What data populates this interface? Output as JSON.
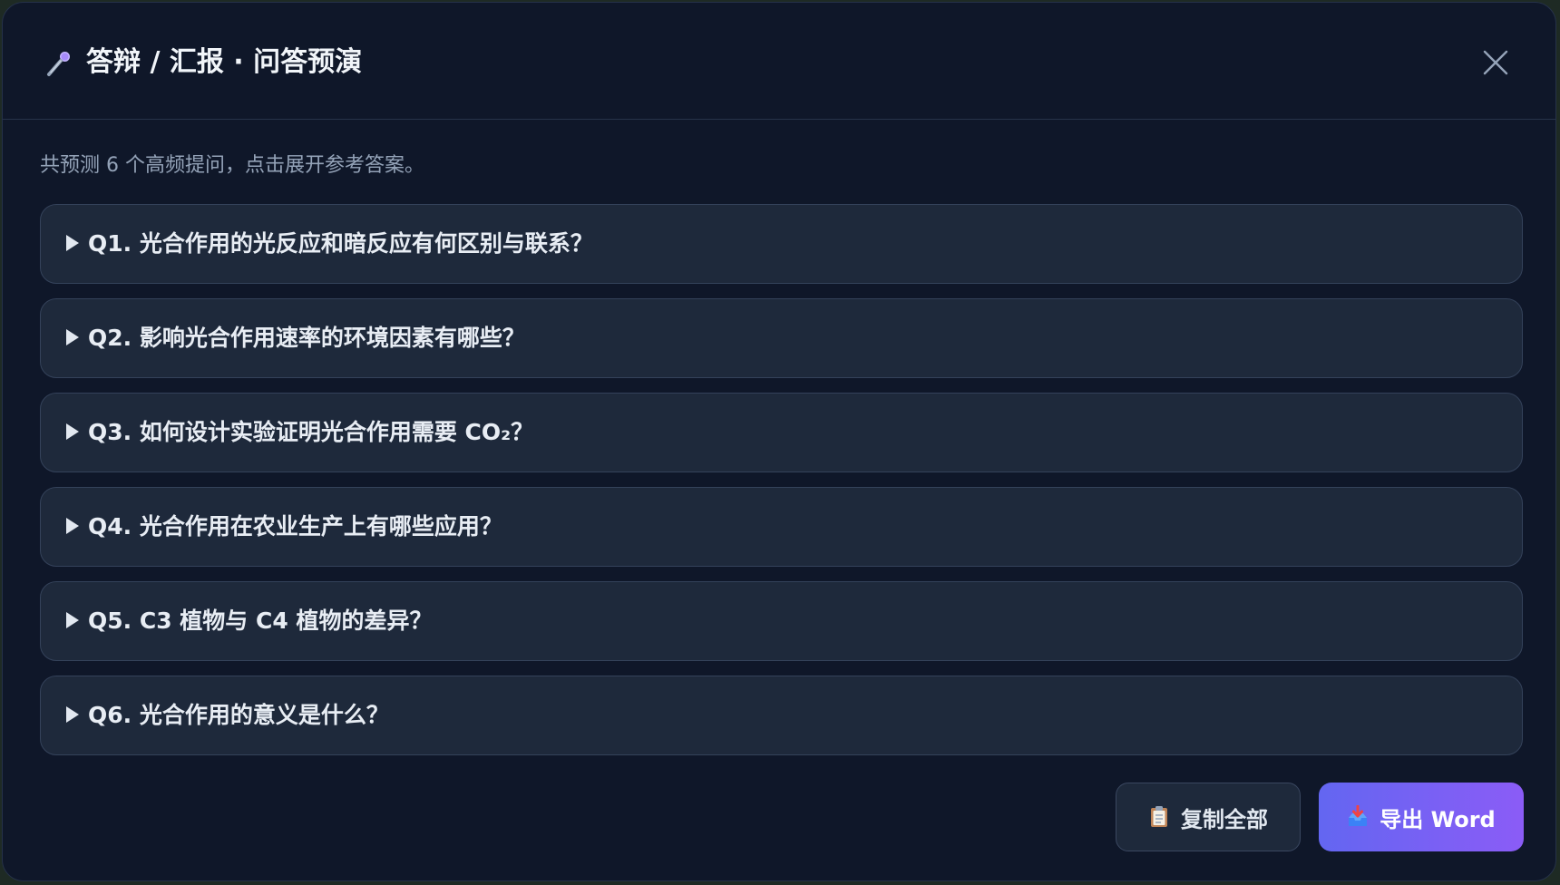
{
  "dialog": {
    "title_icon": "microphone-icon",
    "title": "答辩 / 汇报 · 问答预演",
    "close_icon": "close-icon"
  },
  "summary": "共预测 6 个高频提问，点击展开参考答案。",
  "questions": [
    {
      "label": "Q1. 光合作用的光反应和暗反应有何区别与联系？"
    },
    {
      "label": "Q2. 影响光合作用速率的环境因素有哪些？"
    },
    {
      "label": "Q3. 如何设计实验证明光合作用需要 CO₂？"
    },
    {
      "label": "Q4. 光合作用在农业生产上有哪些应用？"
    },
    {
      "label": "Q5. C3 植物与 C4 植物的差异？"
    },
    {
      "label": "Q6. 光合作用的意义是什么？"
    }
  ],
  "actions": {
    "copy_label": "复制全部",
    "copy_icon": "clipboard-icon",
    "export_label": "导出 Word",
    "export_icon": "inbox-tray-icon"
  },
  "colors": {
    "background": "#0f1729",
    "card": "#1e293b",
    "accent_start": "#6366f1",
    "accent_end": "#8b5cf6"
  }
}
